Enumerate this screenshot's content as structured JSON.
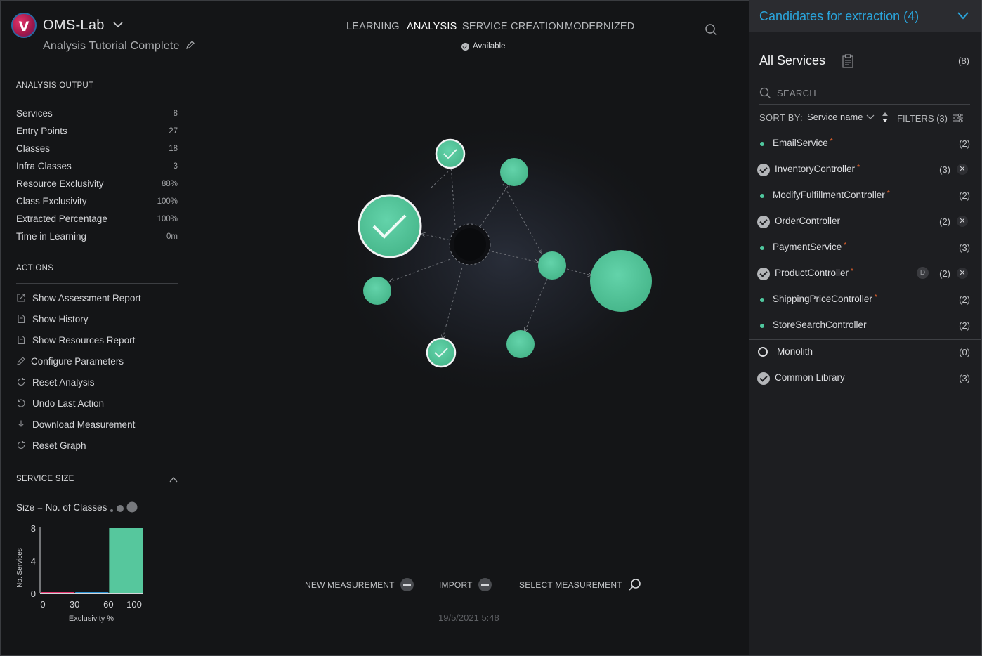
{
  "app": {
    "title": "OMS-Lab",
    "subtitle": "Analysis Tutorial Complete"
  },
  "analysis_output": {
    "heading": "ANALYSIS OUTPUT",
    "metrics": [
      {
        "label": "Services",
        "value": "8"
      },
      {
        "label": "Entry Points",
        "value": "27"
      },
      {
        "label": "Classes",
        "value": "18"
      },
      {
        "label": "Infra Classes",
        "value": "3"
      },
      {
        "label": "Resource Exclusivity",
        "value": "88%"
      },
      {
        "label": "Class Exclusivity",
        "value": "100%"
      },
      {
        "label": "Extracted Percentage",
        "value": "100%"
      },
      {
        "label": "Time in Learning",
        "value": "0m"
      }
    ]
  },
  "actions": {
    "heading": "ACTIONS",
    "items": [
      {
        "label": "Show Assessment Report",
        "icon": "external-link-icon"
      },
      {
        "label": "Show History",
        "icon": "document-icon"
      },
      {
        "label": "Show Resources Report",
        "icon": "document-icon"
      },
      {
        "label": "Configure Parameters",
        "icon": "pencil-icon"
      },
      {
        "label": "Reset Analysis",
        "icon": "refresh-icon"
      },
      {
        "label": "Undo Last Action",
        "icon": "undo-icon"
      },
      {
        "label": "Download Measurement",
        "icon": "download-icon"
      },
      {
        "label": "Reset Graph",
        "icon": "refresh-icon"
      }
    ]
  },
  "service_size": {
    "heading": "SERVICE SIZE",
    "size_label": "Size = No. of Classes"
  },
  "chart_data": {
    "type": "bar",
    "xlabel": "Exclusivity %",
    "ylabel": "No. Services",
    "x_ticks": [
      "0",
      "30",
      "60",
      "100"
    ],
    "y_ticks": [
      "0",
      "4",
      "8"
    ],
    "xlim": [
      0,
      100
    ],
    "ylim": [
      0,
      8
    ],
    "bins": [
      {
        "from": 0,
        "to": 33,
        "value": 0,
        "color": "#e0336d"
      },
      {
        "from": 33,
        "to": 66,
        "value": 0,
        "color": "#2a8fd0"
      },
      {
        "from": 66,
        "to": 100,
        "value": 8,
        "color": "#56c79d"
      }
    ]
  },
  "tabs": [
    {
      "label": "LEARNING",
      "active": false
    },
    {
      "label": "ANALYSIS",
      "active": true
    },
    {
      "label": "SERVICE CREATION",
      "active": false
    },
    {
      "label": "MODERNIZED",
      "active": false
    }
  ],
  "status": {
    "label": "Available"
  },
  "bottom": {
    "new_measurement": "NEW MEASUREMENT",
    "import": "IMPORT",
    "select_measurement": "SELECT MEASUREMENT",
    "timestamp": "19/5/2021 5:48"
  },
  "colors": {
    "accent": "#2aa5dc",
    "node": "#56c79d",
    "required_star": "#f0662c",
    "background": "#141517",
    "panel": "#1d1e21"
  },
  "right_panel": {
    "candidates_title": "Candidates for extraction (4)",
    "all_services_label": "All Services",
    "all_services_count": "(8)",
    "search_placeholder": "SEARCH",
    "sort_by_label": "SORT BY:",
    "sort_value": "Service name",
    "filters_label": "FILTERS (3)",
    "services": [
      {
        "name": "EmailService",
        "count": "(2)",
        "marker": "bullet",
        "required": "*",
        "removable": false,
        "badge": ""
      },
      {
        "name": "InventoryController",
        "count": "(3)",
        "marker": "check",
        "required": "*",
        "removable": true,
        "badge": ""
      },
      {
        "name": "ModifyFulfillmentController",
        "count": "(2)",
        "marker": "bullet",
        "required": "*",
        "removable": false,
        "badge": ""
      },
      {
        "name": "OrderController",
        "count": "(2)",
        "marker": "check",
        "required": "",
        "removable": true,
        "badge": ""
      },
      {
        "name": "PaymentService",
        "count": "(3)",
        "marker": "bullet",
        "required": "*",
        "removable": false,
        "badge": ""
      },
      {
        "name": "ProductController",
        "count": "(2)",
        "marker": "check",
        "required": "*",
        "removable": true,
        "badge": "D"
      },
      {
        "name": "ShippingPriceController",
        "count": "(2)",
        "marker": "bullet",
        "required": "*",
        "removable": false,
        "badge": ""
      },
      {
        "name": "StoreSearchController",
        "count": "(2)",
        "marker": "bullet",
        "required": "",
        "removable": false,
        "badge": ""
      }
    ],
    "other": [
      {
        "name": "Monolith",
        "count": "(0)",
        "marker": "ring"
      },
      {
        "name": "Common Library",
        "count": "(3)",
        "marker": "check"
      }
    ]
  }
}
